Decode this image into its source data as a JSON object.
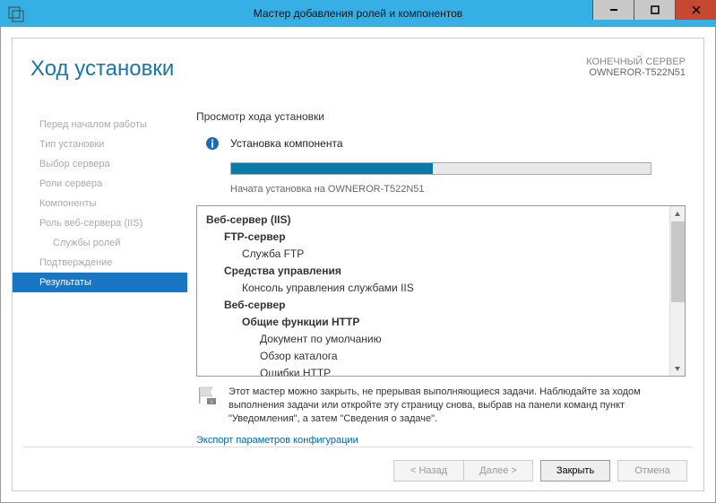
{
  "titlebar": {
    "title": "Мастер добавления ролей и компонентов"
  },
  "header": {
    "page_title": "Ход установки",
    "server_label": "КОНЕЧНЫЙ СЕРВЕР",
    "server_name": "OWNEROR-T522N51"
  },
  "sidebar": {
    "items": [
      {
        "label": "Перед началом работы",
        "active": false
      },
      {
        "label": "Тип установки",
        "active": false
      },
      {
        "label": "Выбор сервера",
        "active": false
      },
      {
        "label": "Роли сервера",
        "active": false
      },
      {
        "label": "Компоненты",
        "active": false
      },
      {
        "label": "Роль веб-сервера (IIS)",
        "active": false
      },
      {
        "label": "Службы ролей",
        "active": false,
        "indent": true
      },
      {
        "label": "Подтверждение",
        "active": false
      },
      {
        "label": "Результаты",
        "active": true
      }
    ]
  },
  "main": {
    "section_title": "Просмотр хода установки",
    "status_text": "Установка компонента",
    "progress_percent": 48,
    "progress_text": "Начата установка на OWNEROR-T522N51",
    "tree": [
      {
        "label": "Веб-сервер (IIS)",
        "level": 0,
        "bold": true
      },
      {
        "label": "FTP-сервер",
        "level": 1,
        "bold": true
      },
      {
        "label": "Служба FTP",
        "level": 2,
        "bold": false
      },
      {
        "label": "Средства управления",
        "level": 1,
        "bold": true
      },
      {
        "label": "Консоль управления службами IIS",
        "level": 2,
        "bold": false
      },
      {
        "label": "Веб-сервер",
        "level": 1,
        "bold": true
      },
      {
        "label": "Общие функции HTTP",
        "level": 2,
        "bold": true
      },
      {
        "label": "Документ по умолчанию",
        "level": 3,
        "bold": false
      },
      {
        "label": "Обзор каталога",
        "level": 3,
        "bold": false
      },
      {
        "label": "Ошибки HTTP",
        "level": 3,
        "bold": false
      }
    ],
    "note_text": "Этот мастер можно закрыть, не прерывая выполняющиеся задачи. Наблюдайте за ходом выполнения задачи или откройте эту страницу снова, выбрав на панели команд пункт \"Уведомления\", а затем \"Сведения о задаче\".",
    "export_link": "Экспорт параметров конфигурации"
  },
  "footer": {
    "back": "< Назад",
    "next": "Далее >",
    "close": "Закрыть",
    "cancel": "Отмена"
  }
}
